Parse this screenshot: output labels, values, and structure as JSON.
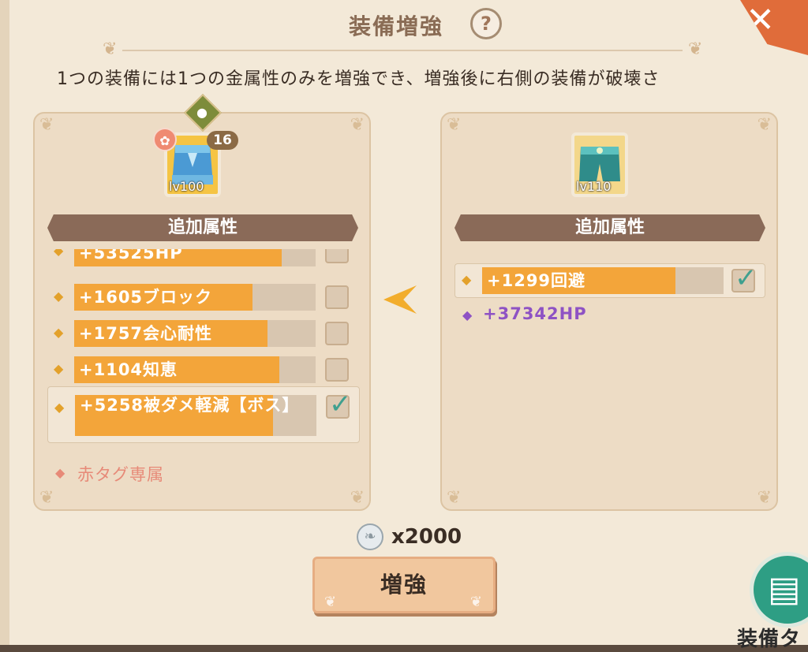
{
  "header": {
    "title": "装備増強",
    "help_glyph": "?",
    "close_glyph": "✕"
  },
  "description": "1つの装備には1つの金属性のみを増強でき、増強後に右側の装備が破壊さ",
  "left_card": {
    "item_level": "lv100",
    "count_badge": "16",
    "section_title": "追加属性",
    "attributes": [
      {
        "text": "+53525HP",
        "fill": 0.86,
        "checked": false
      },
      {
        "text": "+1605ブロック",
        "fill": 0.74,
        "checked": false
      },
      {
        "text": "+1757会心耐性",
        "fill": 0.8,
        "checked": false
      },
      {
        "text": "+1104知恵",
        "fill": 0.85,
        "checked": false
      },
      {
        "text": "+5258被ダメ軽減【ボス】",
        "fill": 0.82,
        "checked": true
      }
    ],
    "exclusive_note": "赤タグ専属"
  },
  "right_card": {
    "item_level": "lv110",
    "section_title": "追加属性",
    "attributes": [
      {
        "text": "+1299回避",
        "fill": 0.8,
        "checked": true
      }
    ],
    "extra_attribute": "+37342HP"
  },
  "cost": {
    "amount": "x2000"
  },
  "enhance_button": "増強",
  "side_button": {
    "label": "装備タ"
  },
  "colors": {
    "panel": "#f3e9d8",
    "card": "#eddcc5",
    "bar_fill": "#f3a53a",
    "section_bar": "#8a6a58",
    "close": "#e06c3a",
    "book_button": "#2e9e84"
  }
}
